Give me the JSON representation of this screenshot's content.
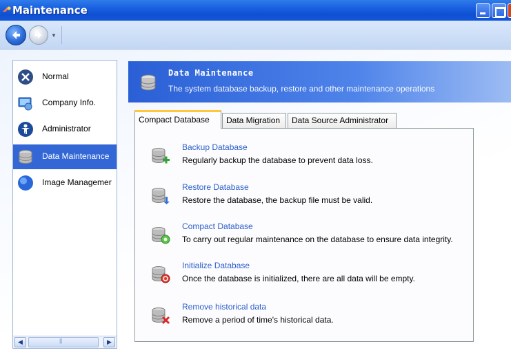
{
  "window": {
    "title": "Maintenance"
  },
  "sidebar": {
    "items": [
      {
        "label": "Normal",
        "icon": "tools-icon"
      },
      {
        "label": "Company Info.",
        "icon": "computer-icon"
      },
      {
        "label": "Administrator",
        "icon": "user-icon"
      },
      {
        "label": "Data Maintenance",
        "icon": "database-icon",
        "selected": true
      },
      {
        "label": "Image Managemer",
        "icon": "globe-icon"
      }
    ]
  },
  "header": {
    "title": "Data Maintenance",
    "subtitle": "The system database backup, restore and other maintenance operations"
  },
  "tabs": [
    {
      "label": "Compact Database",
      "active": true
    },
    {
      "label": "Data Migration"
    },
    {
      "label": "Data Source Administrator"
    }
  ],
  "operations": [
    {
      "title": "Backup Database",
      "description": "Regularly backup the database to prevent data loss.",
      "icon": "database-add-icon"
    },
    {
      "title": "Restore Database",
      "description": "Restore the database, the backup file must be valid.",
      "icon": "database-restore-icon"
    },
    {
      "title": "Compact Database",
      "description": "To carry out regular maintenance on the database to ensure data integrity.",
      "icon": "database-compact-icon"
    },
    {
      "title": "Initialize Database",
      "description": "Once the database is initialized, there are all data will be empty.",
      "icon": "database-reset-icon"
    },
    {
      "title": "Remove historical data",
      "description": "Remove a period of time's historical data.",
      "icon": "database-remove-icon"
    }
  ],
  "colors": {
    "title_bar": "#1960e0",
    "banner": "#2a5fd6",
    "selected": "#3467d6",
    "link": "#2b5ec9",
    "active_tab_accent": "#ffc83c"
  }
}
